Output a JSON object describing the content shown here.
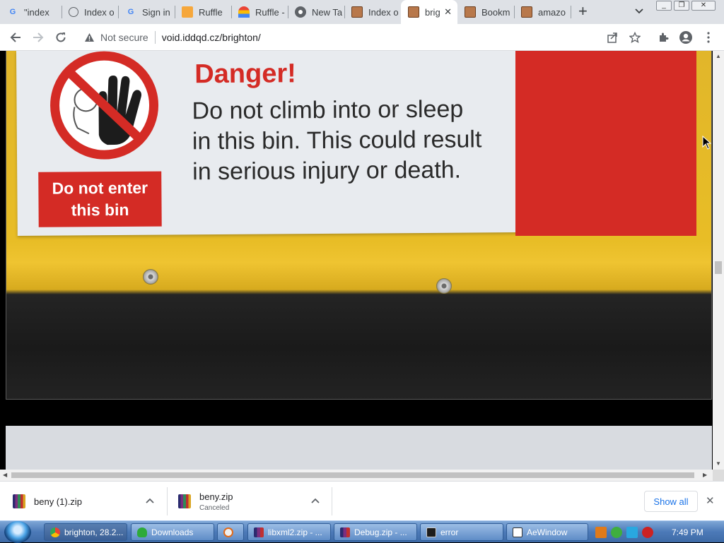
{
  "browser": {
    "tabs": [
      {
        "title": "\"index",
        "favicon": "google-g-icon",
        "active": false
      },
      {
        "title": "Index o",
        "favicon": "globe-icon",
        "active": false
      },
      {
        "title": "Sign in",
        "favicon": "google-g-icon",
        "active": false
      },
      {
        "title": "Ruffle",
        "favicon": "ruffle-icon",
        "active": false
      },
      {
        "title": "Ruffle -",
        "favicon": "ruffle-icon",
        "active": false
      },
      {
        "title": "New Ta",
        "favicon": "chrome-icon",
        "active": false
      },
      {
        "title": "Index o",
        "favicon": "face-icon",
        "active": false
      },
      {
        "title": "brig",
        "favicon": "face-icon",
        "active": true
      },
      {
        "title": "Bookm",
        "favicon": "face-icon",
        "active": false
      },
      {
        "title": "amazo",
        "favicon": "face-icon",
        "active": false
      }
    ],
    "new_tab": "+",
    "address": {
      "security": "Not secure",
      "url": "void.iddqd.cz/brighton/"
    }
  },
  "page": {
    "sign": {
      "heading": "Danger!",
      "body_lines": [
        "Do not climb into or sleep",
        "in this bin. This could result",
        "in serious injury or death."
      ],
      "warning_box_lines": [
        "Do not enter",
        "this bin"
      ]
    },
    "colors": {
      "sign_red": "#d42b25",
      "bin_yellow": "#e8bd26"
    }
  },
  "downloads": {
    "items": [
      {
        "name": "beny (1).zip",
        "status": ""
      },
      {
        "name": "beny.zip",
        "status": "Canceled"
      }
    ],
    "show_all": "Show all"
  },
  "taskbar": {
    "items": [
      {
        "label": "brighton, 28.2...",
        "icon": "chrome-icon",
        "active": true
      },
      {
        "label": "Downloads",
        "icon": "download-icon",
        "active": false
      },
      {
        "label": "",
        "icon": "media-player-icon",
        "active": false
      },
      {
        "label": "libxml2.zip - ...",
        "icon": "winrar-icon",
        "active": false
      },
      {
        "label": "Debug.zip - ...",
        "icon": "winrar-icon",
        "active": false
      },
      {
        "label": "error",
        "icon": "console-icon",
        "active": false
      },
      {
        "label": "AeWindow",
        "icon": "window-icon",
        "active": false
      }
    ],
    "clock": "7:49 PM"
  }
}
